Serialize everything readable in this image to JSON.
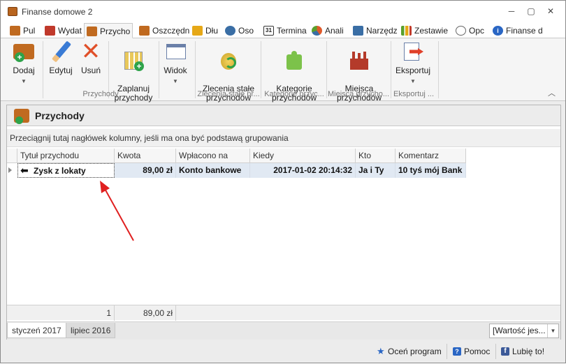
{
  "app": {
    "title": "Finanse domowe 2",
    "window_controls": {
      "minimize": "─",
      "restore": "▢",
      "close": "✕"
    }
  },
  "tabs": [
    {
      "label": "Pul",
      "icon": "wallet-icon",
      "color": "#c06a20"
    },
    {
      "label": "Wydat",
      "icon": "expense-icon",
      "color": "#c0392b"
    },
    {
      "label": "Przycho",
      "icon": "income-icon",
      "color": "#c06a20",
      "active": true
    },
    {
      "label": "Oszczędn",
      "icon": "savings-icon",
      "color": "#c06a20"
    },
    {
      "label": "Dłu",
      "icon": "debt-icon",
      "color": "#e6a817"
    },
    {
      "label": "Oso",
      "icon": "people-icon",
      "color": "#3a6ea5"
    },
    {
      "label": "Termina",
      "icon": "calendar-icon",
      "color": "#333333"
    },
    {
      "label": "Anali",
      "icon": "pie-chart-icon",
      "color": "#e05a2b"
    },
    {
      "label": "Narzędz",
      "icon": "tools-icon",
      "color": "#3a6ea5"
    },
    {
      "label": "Zestawie",
      "icon": "chart-icon",
      "color": "#5aa02c"
    },
    {
      "label": "Opc",
      "icon": "options-icon",
      "color": "#666666"
    },
    {
      "label": "Finanse d",
      "icon": "info-icon",
      "color": "#2a66c4"
    }
  ],
  "ribbon": {
    "buttons": {
      "add": "Dodaj",
      "edit": "Edytuj",
      "delete": "Usuń",
      "plan": "Zaplanuj\nprzychody",
      "view": "Widok",
      "recurring": "Zlecenia stałe\nprzychodów",
      "categories": "Kategorie\nprzychodów",
      "places": "Miejsca\nprzychodów",
      "export": "Eksportuj"
    },
    "groups": {
      "income": "Przychody",
      "recurring": "Zlecenia stałe pr...",
      "categories": "Kategorie przyc...",
      "places": "Miejsca przycho...",
      "export": "Eksportuj ..."
    }
  },
  "panel": {
    "title": "Przychody",
    "group_hint": "Przeciągnij tutaj nagłówek kolumny, jeśli ma ona być podstawą grupowania"
  },
  "grid": {
    "columns": [
      "Tytuł przychodu",
      "Kwota",
      "Wpłacono na",
      "Kiedy",
      "Kto",
      "Komentarz"
    ],
    "rows": [
      {
        "title": "Zysk z lokaty",
        "amount": "89,00 zł",
        "account": "Konto bankowe",
        "when": "2017-01-02 20:14:32",
        "who": "Ja i Ty",
        "comment": "10 tyś mój Bank"
      }
    ],
    "footer": {
      "count": "1",
      "sum": "89,00 zł"
    }
  },
  "sheet_tabs": [
    "styczeń 2017",
    "lipiec 2016"
  ],
  "value_select": "[Wartość jes...",
  "status": {
    "rate": "Oceń program",
    "help": "Pomoc",
    "like": "Lubię to!"
  },
  "colors": {
    "row_highlight": "#e1e9f3",
    "annotation_arrow": "#e02020"
  }
}
